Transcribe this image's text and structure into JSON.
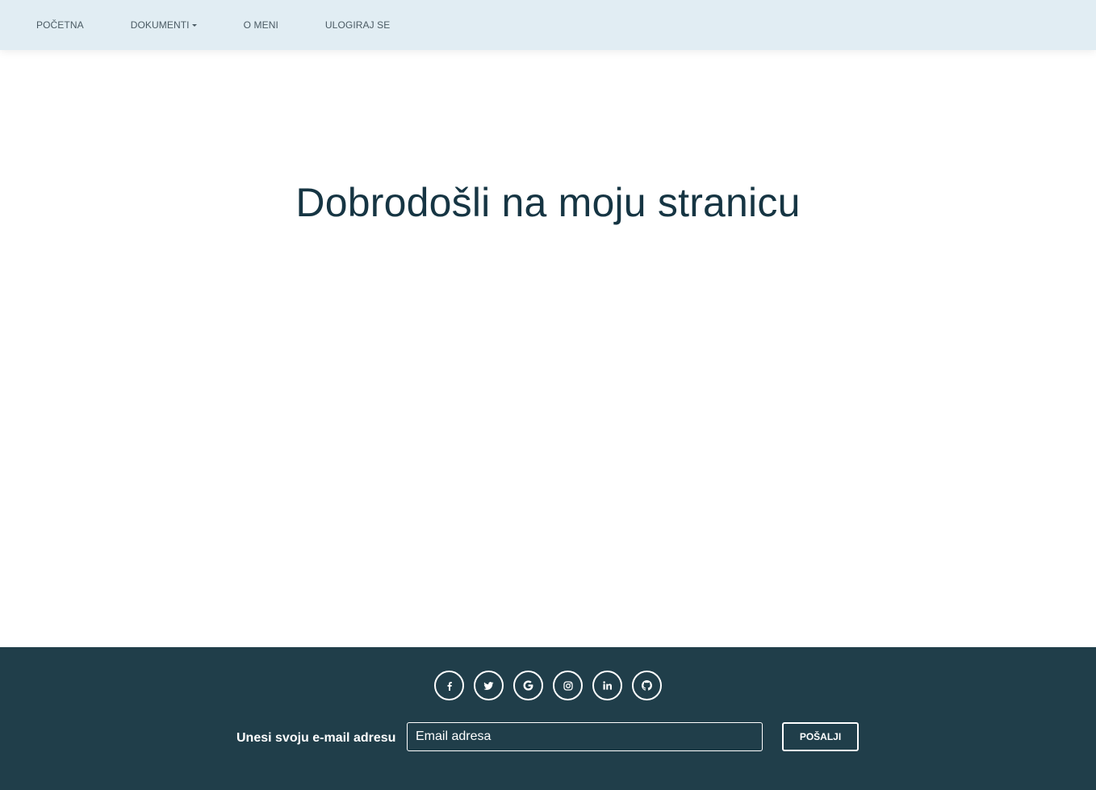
{
  "nav": {
    "items": [
      {
        "label": "POČETNA"
      },
      {
        "label": "DOKUMENTI"
      },
      {
        "label": "O MENI"
      },
      {
        "label": "ULOGIRAJ SE"
      }
    ]
  },
  "hero": {
    "title": "Dobrodošli na moju stranicu"
  },
  "footer": {
    "social": [
      "facebook-icon",
      "twitter-icon",
      "google-icon",
      "instagram-icon",
      "linkedin-icon",
      "github-icon"
    ],
    "email_label": "Unesi svoju e-mail adresu",
    "email_placeholder": "Email adresa",
    "send_label": "POŠALJI"
  },
  "colors": {
    "navbar_bg": "#e1edf3",
    "title": "#163543",
    "footer_bg": "#203e4a"
  }
}
